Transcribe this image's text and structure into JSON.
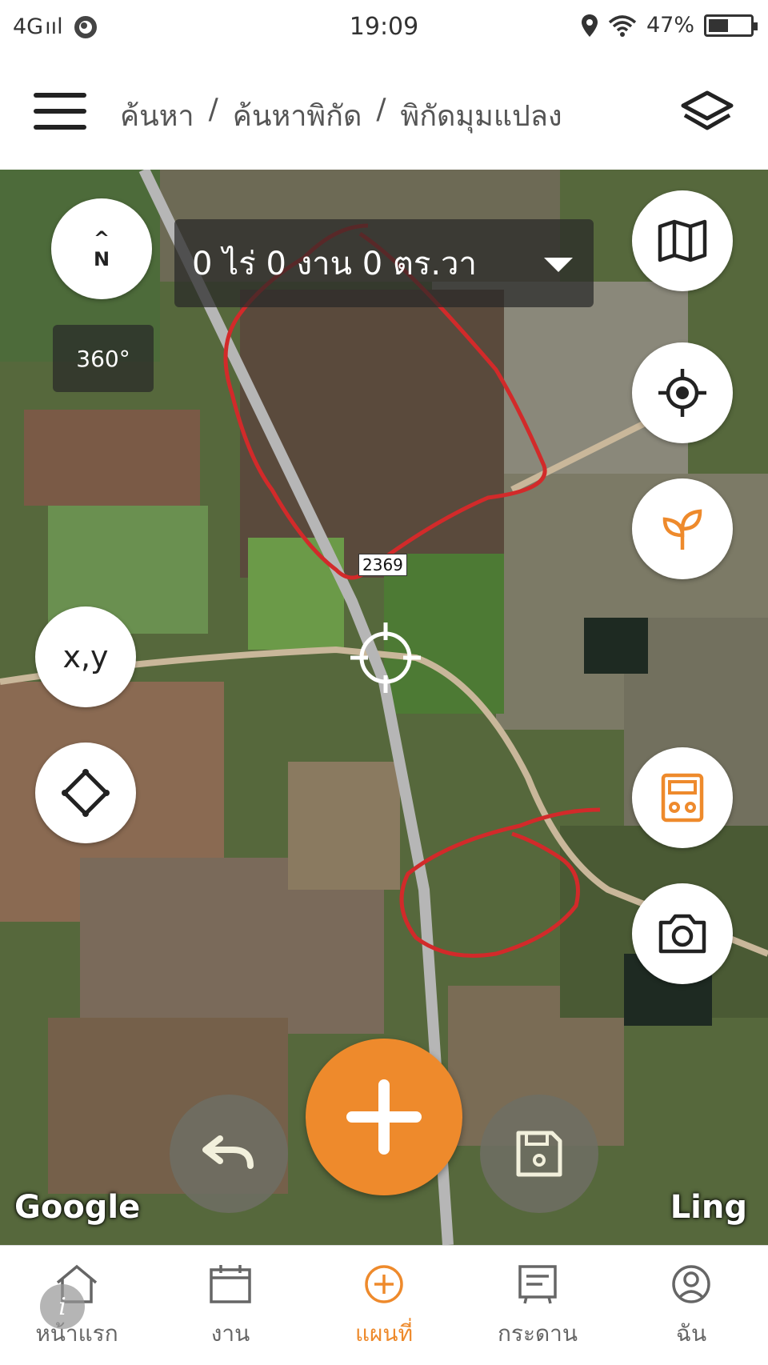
{
  "status_bar": {
    "network": "4G",
    "signal": "ııl",
    "time": "19:09",
    "battery_text": "47%",
    "battery_level": 0.47
  },
  "header": {
    "breadcrumb": [
      "ค้นหา",
      "ค้นหาพิกัด",
      "พิกัดมุมแปลง"
    ],
    "separator": "/"
  },
  "map": {
    "area_readout": "0 ไร่ 0 งาน 0 ตร.วา",
    "compass_arrow": "^",
    "compass_north": "N",
    "btn_360": "360°",
    "btn_xy": "x,y",
    "road_label": "2369",
    "google_logo": "Google",
    "ling_logo": "Ling"
  },
  "icons": {
    "right_column": [
      "map-icon",
      "locate-target-icon",
      "plant-sprout-icon",
      "soil-meter-icon",
      "camera-icon"
    ],
    "left_column": [
      "compass-icon",
      "xy-coordinate-icon",
      "diamond-polygon-icon"
    ]
  },
  "colors": {
    "accent": "#ee8a2c",
    "sketch": "#d22a2a"
  },
  "bottom_nav": {
    "items": [
      {
        "label": "หน้าแรก",
        "icon": "home-icon",
        "active": false
      },
      {
        "label": "งาน",
        "icon": "calendar-icon",
        "active": false
      },
      {
        "label": "แผนที่",
        "icon": "add-circle-icon",
        "active": true
      },
      {
        "label": "กระดาน",
        "icon": "board-icon",
        "active": false
      },
      {
        "label": "ฉัน",
        "icon": "profile-icon",
        "active": false
      }
    ],
    "info_badge": "i"
  }
}
